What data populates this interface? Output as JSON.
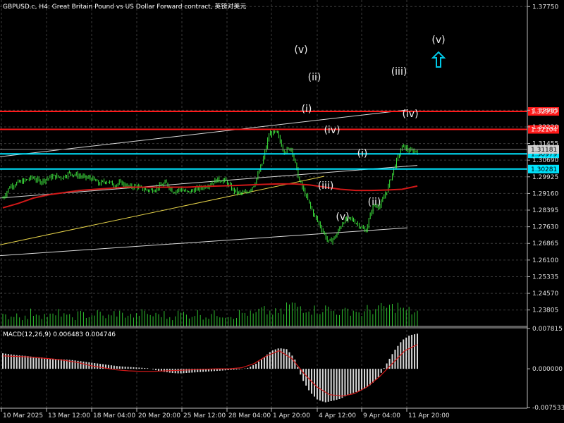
{
  "header": {
    "title": "GBPUSD.c, H4:  Great Britain Pound vs US Dollar Forward contract, 英镑对美元"
  },
  "colors": {
    "background": "#000000",
    "grid": "#3a3a3a",
    "candle": "#3ee83e",
    "ma": "#d01818",
    "resistance": "#ff1a1a",
    "support": "#00e5ff",
    "channel": "#d8d8d8",
    "trendline": "#e6d34a",
    "volume": "#2fbf2f",
    "histogram": "#d9d9d9",
    "signal": "#d01818",
    "arrow": "#00c8e6",
    "price_line": "#8a8a8a"
  },
  "chart_data": [
    {
      "type": "candlestick",
      "symbol": "GBPUSD.c",
      "timeframe": "H4",
      "ylim": [
        1.2305,
        1.3805
      ],
      "y_ticks": [
        "1.37750",
        "1.32985",
        "1.32220",
        "1.31455",
        "1.30690",
        "1.29925",
        "1.29160",
        "1.28395",
        "1.27630",
        "1.26865",
        "1.26100",
        "1.25335",
        "1.24570",
        "1.23805"
      ],
      "x_ticks": [
        "10 Mar 2025",
        "13 Mar 12:00",
        "18 Mar 04:00",
        "20 Mar 20:00",
        "25 Mar 12:00",
        "28 Mar 04:00",
        "1 Apr 20:00",
        "4 Apr 12:00",
        "9 Apr 04:00",
        "11 Apr 20:00"
      ],
      "close_path": [
        1.2895,
        1.295,
        1.2965,
        1.2975,
        1.299,
        1.297,
        1.2985,
        1.2995,
        1.299,
        1.301,
        1.3,
        1.299,
        1.2985,
        1.296,
        1.2975,
        1.2955,
        1.2965,
        1.2945,
        1.295,
        1.2935,
        1.293,
        1.2945,
        1.2965,
        1.2925,
        1.2935,
        1.292,
        1.2935,
        1.2945,
        1.296,
        1.298,
        1.2975,
        1.2935,
        1.2915,
        1.292,
        1.296,
        1.305,
        1.319,
        1.3195,
        1.311,
        1.3125,
        1.298,
        1.29,
        1.282,
        1.276,
        1.269,
        1.272,
        1.279,
        1.28,
        1.2775,
        1.274,
        1.286,
        1.286,
        1.294,
        1.305,
        1.3135,
        1.311,
        1.3112
      ],
      "moving_average": [
        1.285,
        1.287,
        1.2895,
        1.291,
        1.292,
        1.293,
        1.2935,
        1.294,
        1.2945,
        1.2945,
        1.2945,
        1.2945,
        1.2945,
        1.2948,
        1.295,
        1.2952,
        1.2955,
        1.2958,
        1.296,
        1.296,
        1.2955,
        1.2945,
        1.2935,
        1.293,
        1.293,
        1.2932,
        1.2935,
        1.295
      ],
      "volume": [
        0.45,
        0.55,
        0.4,
        0.62,
        0.5,
        0.48,
        0.6,
        0.42,
        0.55,
        0.5,
        0.58,
        0.45,
        0.6,
        0.52,
        0.47,
        0.6,
        0.5,
        0.55,
        0.42,
        0.58,
        0.5,
        0.6,
        0.45,
        0.55,
        0.52,
        0.48,
        0.6,
        0.55,
        0.7,
        0.65,
        0.62,
        0.95,
        0.9,
        0.85,
        0.75,
        0.8,
        0.7,
        0.65,
        0.72,
        0.6,
        0.75,
        0.8,
        0.85,
        0.9,
        0.7,
        0.65
      ],
      "horizontal_levels": [
        {
          "label": "1.32930",
          "price": 1.3293,
          "kind": "resistance"
        },
        {
          "label": "1.32104",
          "price": 1.32104,
          "kind": "resistance"
        },
        {
          "label": "1.30979",
          "price": 1.30979,
          "kind": "support"
        },
        {
          "label": "1.30281",
          "price": 1.30281,
          "kind": "support"
        }
      ],
      "current_price_label": "1.31181",
      "current_price": 1.31181,
      "wave_labels": [
        "(v)",
        "(ii)",
        "(i)",
        "(iv)",
        "(iii)",
        "(v)",
        "(i)",
        "(ii)",
        "(iii)",
        "(iv)",
        "(v)"
      ]
    },
    {
      "type": "histogram",
      "title": "MACD(12,26,9) 0.006483 0.004746",
      "ylim": [
        -0.0075,
        0.0078
      ],
      "y_ticks": [
        "0.007815",
        "0.000000",
        "-0.007533"
      ],
      "histogram": [
        0.003,
        0.0028,
        0.0026,
        0.0025,
        0.0023,
        0.0022,
        0.002,
        0.0019,
        0.0018,
        0.0017,
        0.0015,
        0.0013,
        0.0011,
        0.0009,
        0.0007,
        0.0005,
        0.0004,
        0.0003,
        0.0002,
        0.0001,
        -0.0003,
        -0.0006,
        -0.0008,
        -0.0009,
        -0.0008,
        -0.0007,
        -0.0006,
        -0.0005,
        -0.0004,
        -0.0003,
        -0.0002,
        -0.0001,
        0.0002,
        0.001,
        0.0022,
        0.0035,
        0.004,
        0.0038,
        0.002,
        -0.002,
        -0.0045,
        -0.006,
        -0.0065,
        -0.0062,
        -0.0058,
        -0.005,
        -0.0045,
        -0.004,
        -0.003,
        -0.0015,
        0.001,
        0.0035,
        0.0055,
        0.0065,
        0.0068
      ],
      "signal": [
        0.0025,
        0.0024,
        0.0023,
        0.0021,
        0.0019,
        0.0016,
        0.0012,
        0.0006,
        0.0002,
        -0.0002,
        -0.0004,
        -0.0005,
        -0.0005,
        -0.0004,
        -0.0003,
        -0.0002,
        -0.0001,
        0.0,
        0.0,
        0.0002,
        0.001,
        0.0025,
        0.0035,
        0.002,
        -0.001,
        -0.0035,
        -0.005,
        -0.0053,
        -0.0048,
        -0.0035,
        -0.0015,
        0.001,
        0.0035,
        0.0047
      ]
    }
  ]
}
